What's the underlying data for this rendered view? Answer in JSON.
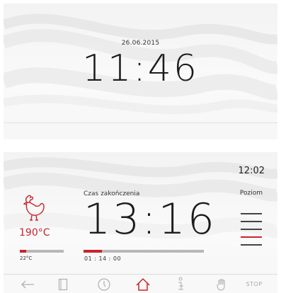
{
  "top_screen": {
    "date": "26.06.2015",
    "time": "11:46"
  },
  "bottom_screen": {
    "current_time": "12:02",
    "level_label": "Poziom",
    "levels": {
      "count": 5,
      "selected": 4
    },
    "program_icon": "chicken-icon",
    "set_temperature": "190°C",
    "current_temperature": "22°C",
    "temperature_progress": 0.15,
    "end_time_label": "Czas zakończenia",
    "end_time": "13:16",
    "remaining_time": "01 : 14 : 00",
    "time_progress": 0.15,
    "nav": {
      "icons": [
        "back-arrow-icon",
        "book-icon",
        "clock-icon",
        "home-icon",
        "info-icon",
        "hand-icon"
      ],
      "stop_label": "STOP"
    }
  },
  "colors": {
    "accent": "#c8242c",
    "text": "#1c1c1c",
    "inactive": "#b0b0b0"
  }
}
